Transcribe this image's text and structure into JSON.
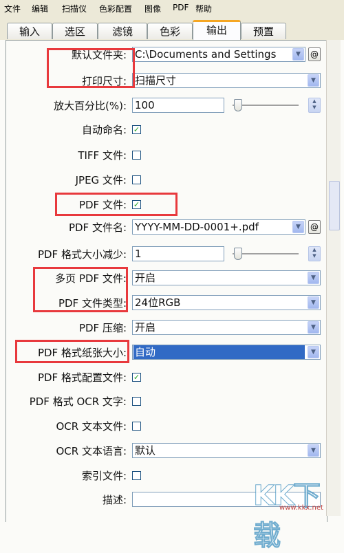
{
  "menu": [
    "文件",
    "编辑",
    "扫描仪",
    "色彩配置",
    "图像",
    "PDF",
    "帮助"
  ],
  "tabs": [
    "输入",
    "选区",
    "滤镜",
    "色彩",
    "输出",
    "预置"
  ],
  "active_tab": "输出",
  "rows": {
    "default_folder": {
      "label": "默认文件夹:",
      "value": "C:\\Documents and Settings"
    },
    "print_size": {
      "label": "打印尺寸:",
      "value": "扫描尺寸"
    },
    "zoom_percent": {
      "label": "放大百分比(%):",
      "value": "100"
    },
    "auto_name": {
      "label": "自动命名:",
      "checked": true
    },
    "tiff_file": {
      "label": "TIFF 文件:",
      "checked": false
    },
    "jpeg_file": {
      "label": "JPEG 文件:",
      "checked": false
    },
    "pdf_file": {
      "label": "PDF 文件:",
      "checked": true
    },
    "pdf_filename": {
      "label": "PDF 文件名:",
      "value": "YYYY-MM-DD-0001+.pdf"
    },
    "pdf_size_reduce": {
      "label": "PDF 格式大小减少:",
      "value": "1"
    },
    "multipage_pdf": {
      "label": "多页 PDF 文件:",
      "value": "开启"
    },
    "pdf_file_type": {
      "label": "PDF 文件类型:",
      "value": "24位RGB"
    },
    "pdf_compress": {
      "label": "PDF 压缩:",
      "value": "开启"
    },
    "pdf_paper_size": {
      "label": "PDF 格式纸张大小:",
      "value": "自动"
    },
    "pdf_config_file": {
      "label": "PDF 格式配置文件:",
      "checked": true
    },
    "pdf_ocr_text": {
      "label": "PDF 格式 OCR 文字:",
      "checked": false
    },
    "ocr_text_file": {
      "label": "OCR 文本文件:",
      "checked": false
    },
    "ocr_language": {
      "label": "OCR 文本语言:",
      "value": "默认"
    },
    "index_file": {
      "label": "索引文件:",
      "checked": false
    },
    "description": {
      "label": "描述:",
      "value": ""
    }
  },
  "at_button_label": "@",
  "check_mark": "✓",
  "dropdown_glyph": "▼",
  "spinner_up": "▲",
  "spinner_down": "▼",
  "watermark": {
    "text": "KK下载",
    "url": "www.kkx.net"
  },
  "colors": {
    "highlight": "#e8393d",
    "selection": "#316ac5",
    "tab_active": "#f5a623"
  }
}
